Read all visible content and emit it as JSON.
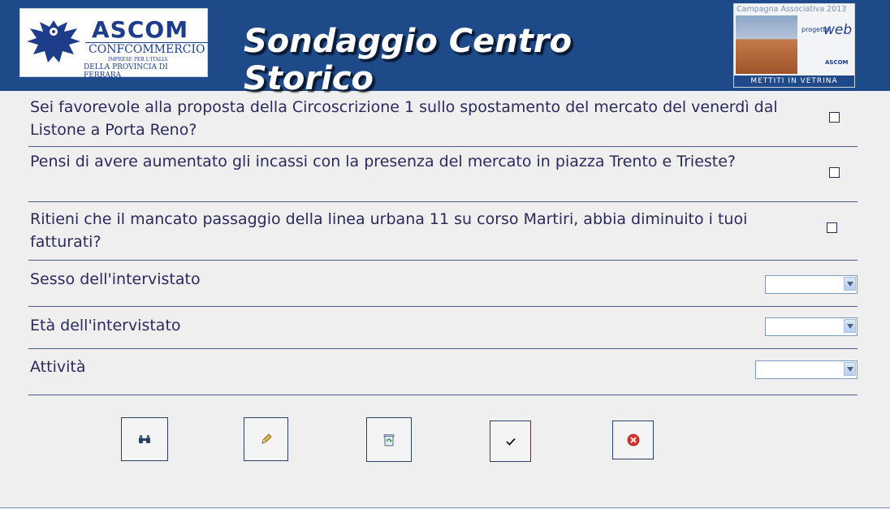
{
  "header": {
    "title": "Sondaggio Centro Storico",
    "logo_left": {
      "name": "ASCOM",
      "subtitle": "CONFCOMMERCIO",
      "tagline": "IMPRESE PER L'ITALIA",
      "province": "DELLA PROVINCIA DI FERRARA"
    },
    "logo_right": {
      "campaign": "Campagna Associativa 2013",
      "progetto": "progetto",
      "web": "web",
      "ascom": "ASCOM",
      "slogan": "METTITI IN VETRINA"
    }
  },
  "questions": [
    {
      "text": "Sei favorevole alla proposta della Circoscrizione 1 sullo spostamento del mercato del venerdì dal Listone a Porta Reno?",
      "checked": false
    },
    {
      "text": "Pensi di avere aumentato gli incassi con la presenza del mercato in piazza Trento e Trieste?",
      "checked": false
    },
    {
      "text": "Ritieni che il mancato passaggio della linea urbana 11 su corso Martiri, abbia diminuito i tuoi fatturati?",
      "checked": false
    }
  ],
  "fields": [
    {
      "label": "Sesso dell'intervistato",
      "value": ""
    },
    {
      "label": "Età dell'intervistato",
      "value": ""
    },
    {
      "label": "Attività",
      "value": ""
    }
  ],
  "toolbar": {
    "buttons": [
      {
        "name": "search",
        "icon": "binoculars-icon"
      },
      {
        "name": "edit",
        "icon": "pencil-icon"
      },
      {
        "name": "delete",
        "icon": "recycle-bin-icon"
      },
      {
        "name": "confirm",
        "icon": "checkmark-icon"
      },
      {
        "name": "cancel",
        "icon": "close-circle-icon"
      }
    ]
  },
  "colors": {
    "header_bg": "#1f4a8a",
    "text": "#2b2a5e",
    "background": "#efefef",
    "cancel_red": "#d9342b"
  }
}
